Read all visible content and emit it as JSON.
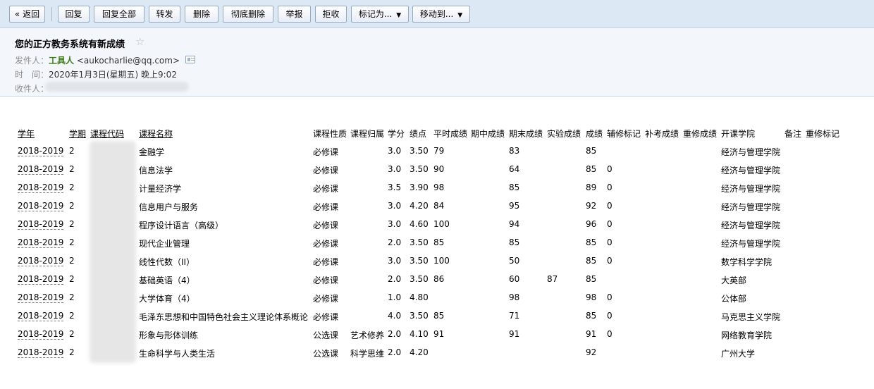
{
  "toolbar": {
    "buttons": [
      "« 返回",
      "回复",
      "回复全部",
      "转发",
      "删除",
      "彻底删除",
      "举报",
      "拒收",
      "标记为...",
      "移动到..."
    ],
    "dropdown_caret": "▼"
  },
  "email": {
    "subject": "您的正方教务系统有新成绩",
    "star": "☆",
    "from_label": "发件人：",
    "from_name": "工具人",
    "from_email": "<aukocharlie@qq.com>",
    "time_label": "时　间：",
    "time_value": "2020年1月3日(星期五) 晚上9:02",
    "to_label": "收件人："
  },
  "grades_table": {
    "headers": [
      "学年",
      "学期",
      "课程代码",
      "课程名称",
      "课程性质",
      "课程归属",
      "学分",
      "绩点",
      "平时成绩",
      "期中成绩",
      "期末成绩",
      "实验成绩",
      "成绩",
      "辅修标记",
      "补考成绩",
      "重修成绩",
      "开课学院",
      "备注",
      "重修标记"
    ],
    "rows": [
      {
        "year": "2018-2019",
        "term": "2",
        "name": "金融学",
        "nature": "必修课",
        "belong": "",
        "credit": "3.0",
        "gpa": "3.50",
        "usual": "79",
        "mid": "",
        "final": "83",
        "lab": "",
        "score": "85",
        "minor": "",
        "college": "经济与管理学院"
      },
      {
        "year": "2018-2019",
        "term": "2",
        "name": "信息法学",
        "nature": "必修课",
        "belong": "",
        "credit": "3.0",
        "gpa": "3.50",
        "usual": "90",
        "mid": "",
        "final": "64",
        "lab": "",
        "score": "85",
        "minor": "0",
        "college": "经济与管理学院"
      },
      {
        "year": "2018-2019",
        "term": "2",
        "name": "计量经济学",
        "nature": "必修课",
        "belong": "",
        "credit": "3.5",
        "gpa": "3.90",
        "usual": "98",
        "mid": "",
        "final": "85",
        "lab": "",
        "score": "89",
        "minor": "0",
        "college": "经济与管理学院"
      },
      {
        "year": "2018-2019",
        "term": "2",
        "name": "信息用户与服务",
        "nature": "必修课",
        "belong": "",
        "credit": "3.0",
        "gpa": "4.20",
        "usual": "84",
        "mid": "",
        "final": "95",
        "lab": "",
        "score": "92",
        "minor": "0",
        "college": "经济与管理学院"
      },
      {
        "year": "2018-2019",
        "term": "2",
        "name": "程序设计语言（高级）",
        "nature": "必修课",
        "belong": "",
        "credit": "3.0",
        "gpa": "4.60",
        "usual": "100",
        "mid": "",
        "final": "94",
        "lab": "",
        "score": "96",
        "minor": "0",
        "college": "经济与管理学院"
      },
      {
        "year": "2018-2019",
        "term": "2",
        "name": "现代企业管理",
        "nature": "必修课",
        "belong": "",
        "credit": "2.0",
        "gpa": "3.50",
        "usual": "85",
        "mid": "",
        "final": "85",
        "lab": "",
        "score": "85",
        "minor": "0",
        "college": "经济与管理学院"
      },
      {
        "year": "2018-2019",
        "term": "2",
        "name": "线性代数（II）",
        "nature": "必修课",
        "belong": "",
        "credit": "3.0",
        "gpa": "3.50",
        "usual": "100",
        "mid": "",
        "final": "50",
        "lab": "",
        "score": "85",
        "minor": "0",
        "college": "数学科学学院"
      },
      {
        "year": "2018-2019",
        "term": "2",
        "name": "基础英语（4）",
        "nature": "必修课",
        "belong": "",
        "credit": "2.0",
        "gpa": "3.50",
        "usual": "86",
        "mid": "",
        "final": "60",
        "lab": "87",
        "score": "85",
        "minor": "",
        "college": "大英部"
      },
      {
        "year": "2018-2019",
        "term": "2",
        "name": "大学体育（4）",
        "nature": "必修课",
        "belong": "",
        "credit": "1.0",
        "gpa": "4.80",
        "usual": "",
        "mid": "",
        "final": "98",
        "lab": "",
        "score": "98",
        "minor": "0",
        "college": "公体部"
      },
      {
        "year": "2018-2019",
        "term": "2",
        "name": "毛泽东思想和中国特色社会主义理论体系概论",
        "nature": "必修课",
        "belong": "",
        "credit": "4.0",
        "gpa": "3.50",
        "usual": "85",
        "mid": "",
        "final": "71",
        "lab": "",
        "score": "85",
        "minor": "0",
        "college": "马克思主义学院"
      },
      {
        "year": "2018-2019",
        "term": "2",
        "name": "形象与形体训练",
        "nature": "公选课",
        "belong": "艺术修养",
        "credit": "2.0",
        "gpa": "4.10",
        "usual": "91",
        "mid": "",
        "final": "91",
        "lab": "",
        "score": "91",
        "minor": "0",
        "college": "网络教育学院"
      },
      {
        "year": "2018-2019",
        "term": "2",
        "name": "生命科学与人类生活",
        "nature": "公选课",
        "belong": "科学思维",
        "credit": "2.0",
        "gpa": "4.20",
        "usual": "",
        "mid": "",
        "final": "",
        "lab": "",
        "score": "92",
        "minor": "",
        "college": "广州大学"
      }
    ]
  }
}
